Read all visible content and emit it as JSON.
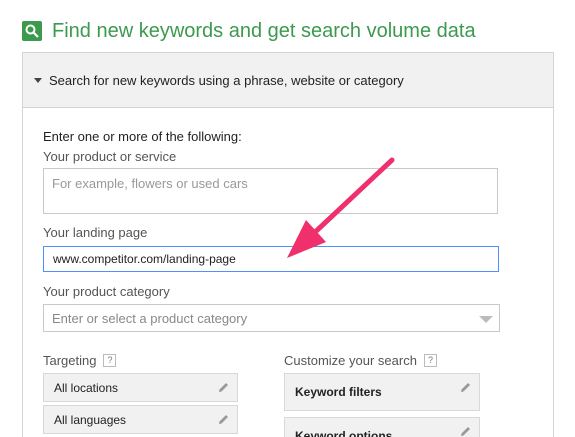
{
  "header": {
    "title": "Find new keywords and get search volume data",
    "icon": "search-icon"
  },
  "panel": {
    "heading": "Search for new keywords using a phrase, website or category",
    "intro": "Enter one or more of the following:",
    "product": {
      "label": "Your product or service",
      "placeholder": "For example, flowers or used cars",
      "value": ""
    },
    "landing": {
      "label": "Your landing page",
      "value": "www.competitor.com/landing-page"
    },
    "category": {
      "label": "Your product category",
      "placeholder": "Enter or select a product category"
    },
    "targeting": {
      "label": "Targeting",
      "help": "?",
      "items": [
        "All locations",
        "All languages"
      ]
    },
    "customize": {
      "label": "Customize your search",
      "help": "?",
      "items": [
        "Keyword filters",
        "Keyword options"
      ]
    }
  },
  "colors": {
    "brand_green": "#3c9a4e",
    "arrow": "#f0306c",
    "focus_border": "#4d90fe"
  }
}
